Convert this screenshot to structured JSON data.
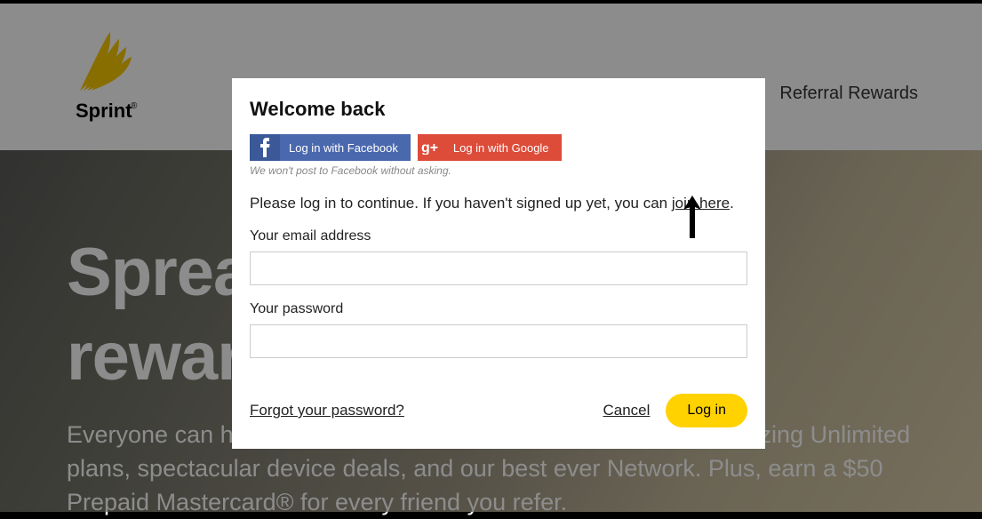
{
  "brand": {
    "name": "Sprint"
  },
  "nav": {
    "referral": "Referral Rewards"
  },
  "hero": {
    "headline_line1": "Spread the word. Earn",
    "headline_line2": "rewards.",
    "subtext": "Everyone can have a great wireless experience with Sprint's amazing Unlimited plans, spectacular device deals, and our best ever Network. Plus, earn a $50 Prepaid Mastercard® for every friend you refer."
  },
  "modal": {
    "title": "Welcome back",
    "fb_label": "Log in with Facebook",
    "google_label": "Log in with Google",
    "fb_note": "We won't post to Facebook without asking.",
    "instruction_pre": "Please log in to continue. If you haven't signed up yet, you can ",
    "instruction_link": "join here",
    "instruction_post": ".",
    "email_label": "Your email address",
    "email_value": "",
    "password_label": "Your password",
    "password_value": "",
    "forgot": "Forgot your password?",
    "cancel": "Cancel",
    "login": "Log in"
  }
}
